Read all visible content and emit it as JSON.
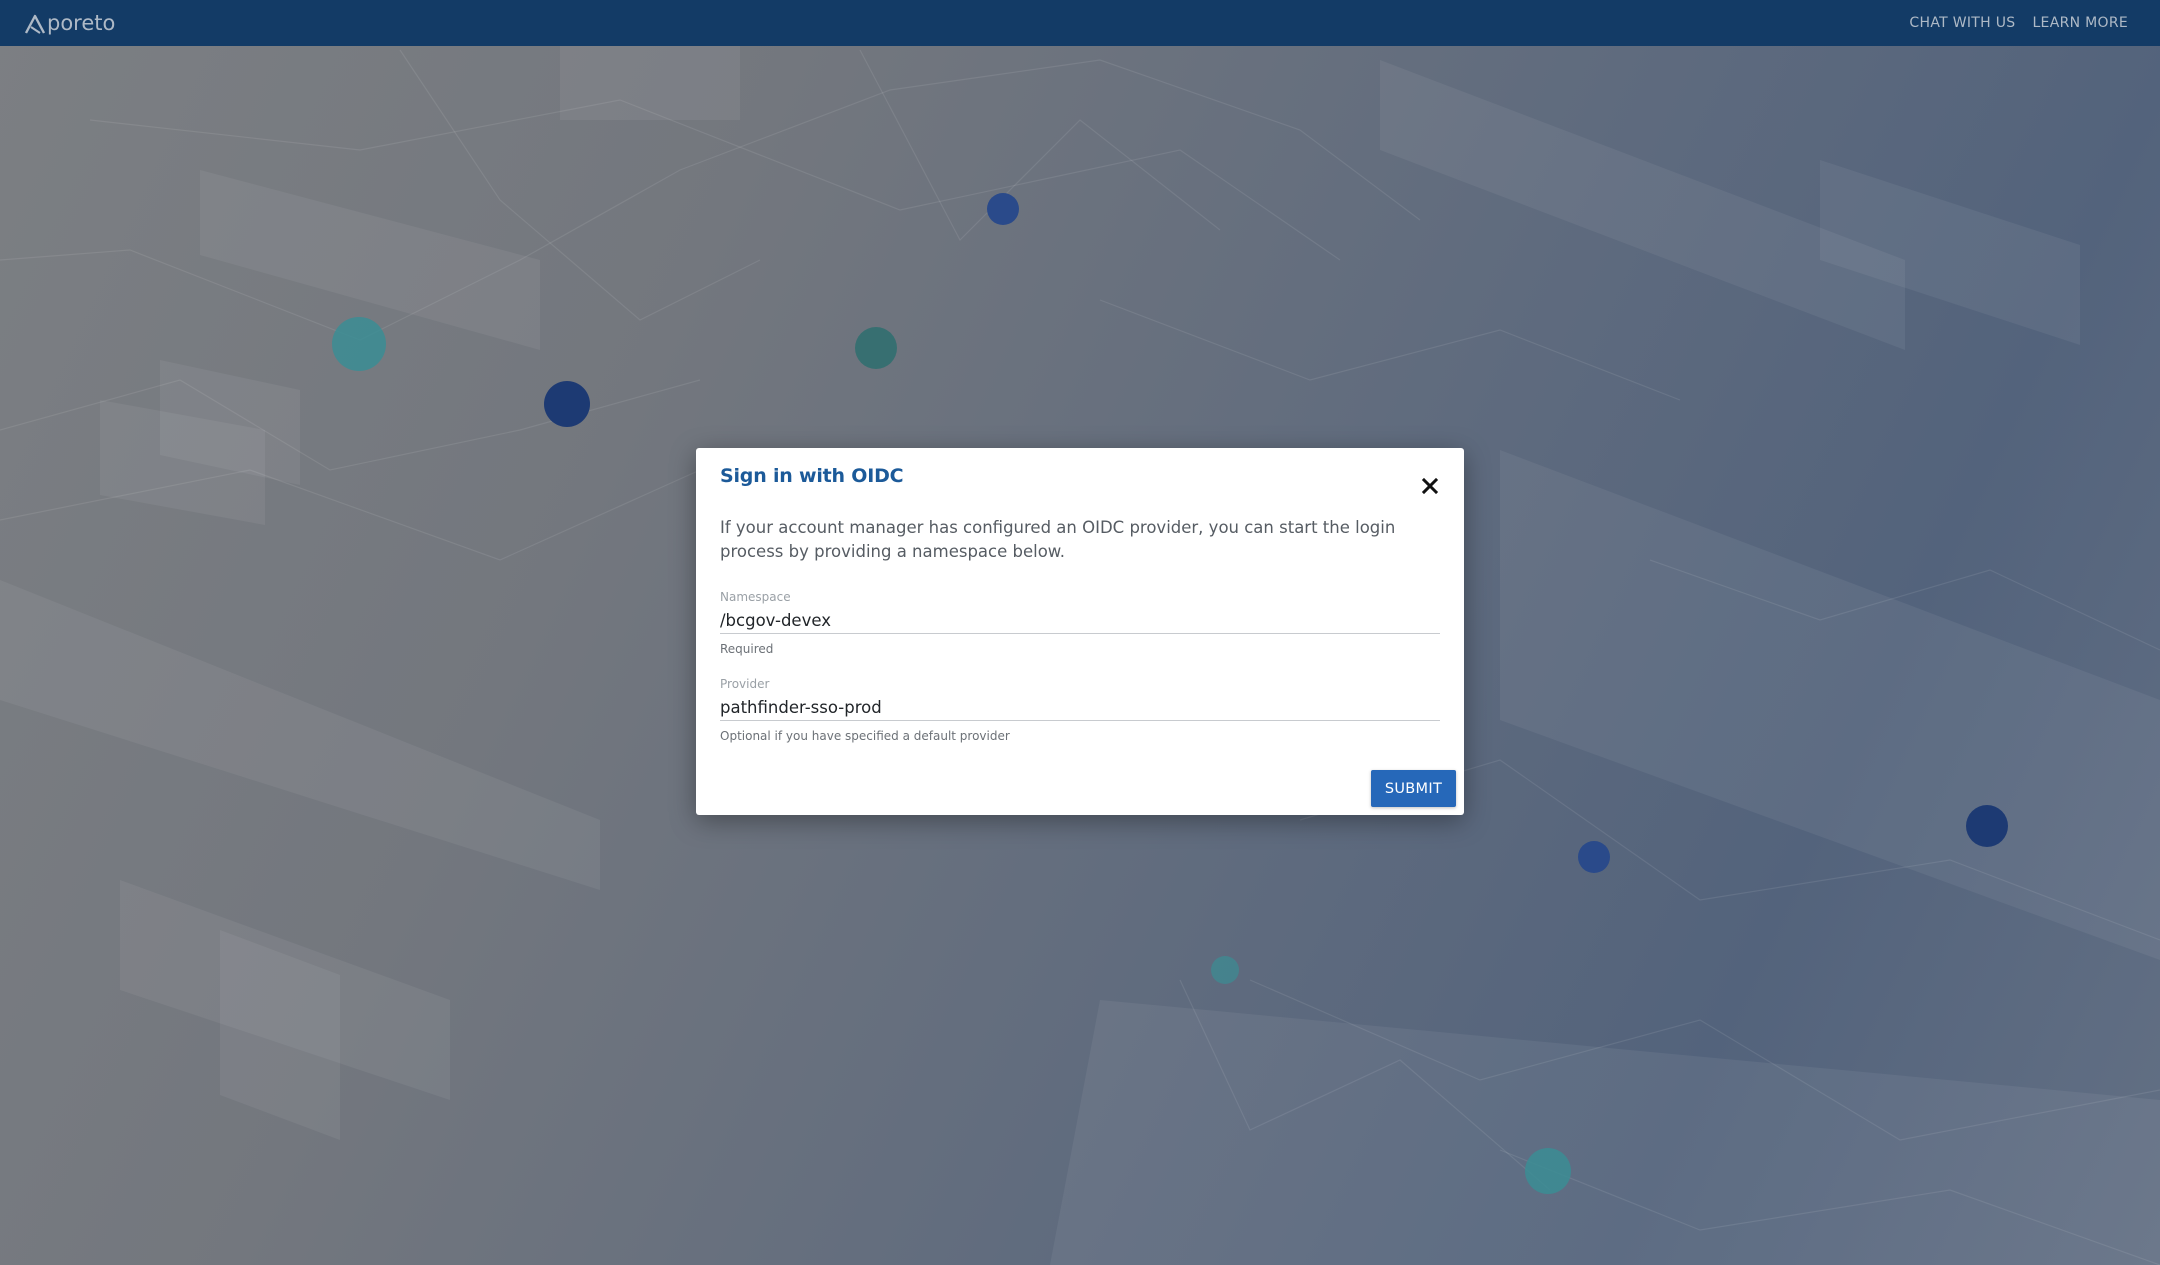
{
  "app": {
    "logo_text": "poreto",
    "brand_color": "#133b66"
  },
  "header": {
    "nav": [
      {
        "label": "CHAT WITH US"
      },
      {
        "label": "LEARN MORE"
      }
    ]
  },
  "dialog": {
    "title": "Sign in with OIDC",
    "description": "If your account manager has configured an OIDC provider, you can start the login process by providing a namespace below.",
    "fields": {
      "namespace": {
        "label": "Namespace",
        "value": "/bcgov-devex",
        "help": "Required"
      },
      "provider": {
        "label": "Provider",
        "value": "pathfinder-sso-prod",
        "help": "Optional if you have specified a default provider"
      }
    },
    "submit_label": "SUBMIT",
    "accent_color": "#2668b9",
    "title_color": "#1c5a99"
  },
  "background": {
    "node_colors": [
      "#1d3a73",
      "#2a4a8a",
      "#3b8d94",
      "#2e6f6e"
    ]
  }
}
